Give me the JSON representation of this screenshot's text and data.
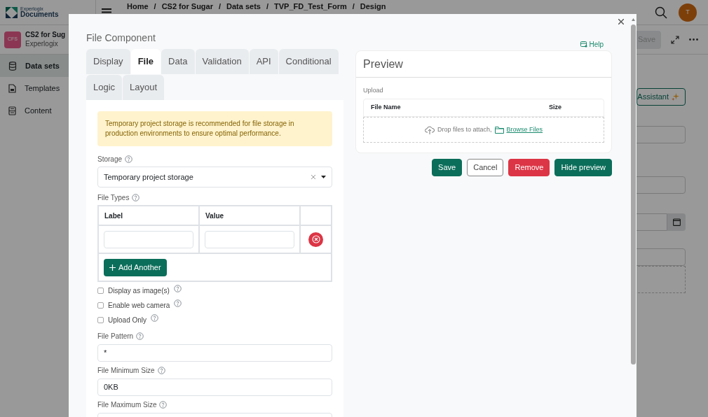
{
  "app": {
    "logo_top": "Experlogix",
    "logo_bottom": "Documents",
    "project": {
      "badge": "CFS",
      "name": "CS2 for Sug",
      "org": "Experlogix"
    },
    "nav": [
      {
        "label": "Data sets",
        "selected": true
      },
      {
        "label": "Templates",
        "selected": false
      },
      {
        "label": "Content",
        "selected": false
      }
    ],
    "breadcrumb": [
      {
        "kind": "link",
        "text": "Home"
      },
      {
        "kind": "separator",
        "text": "/"
      },
      {
        "kind": "link",
        "text": "CS2 for Sugar"
      },
      {
        "kind": "separator",
        "text": "/"
      },
      {
        "kind": "link",
        "text": "Data sets"
      },
      {
        "kind": "separator",
        "text": "/"
      },
      {
        "kind": "link",
        "text": "TVP_FD_Test_Form"
      },
      {
        "kind": "separator",
        "text": "/"
      },
      {
        "kind": "link",
        "text": "Design"
      }
    ],
    "avatar": "T",
    "save": "Save",
    "assistant": "Assistant"
  },
  "modal": {
    "title": "File Component",
    "help": "Help",
    "tabs": [
      {
        "label": "Display",
        "selected": false
      },
      {
        "label": "File",
        "selected": true
      },
      {
        "label": "Data",
        "selected": false
      },
      {
        "label": "Validation",
        "selected": false
      },
      {
        "label": "API",
        "selected": false
      },
      {
        "label": "Conditional",
        "selected": false
      },
      {
        "label": "Logic",
        "selected": false
      },
      {
        "label": "Layout",
        "selected": false
      }
    ],
    "alert": "Temporary project storage is recommended for file storage in production environments to ensure optimal performance.",
    "storage": {
      "label": "Storage",
      "value": "Temporary project storage"
    },
    "file_types": {
      "label": "File Types",
      "columns": [
        "Label",
        "Value"
      ],
      "add_button": "Add Another"
    },
    "checkboxes": [
      {
        "label": "Display as image(s)",
        "checked": false
      },
      {
        "label": "Enable web camera",
        "checked": false
      },
      {
        "label": "Upload Only",
        "checked": false
      }
    ],
    "fields": [
      {
        "label": "File Pattern",
        "value": "*"
      },
      {
        "label": "File Minimum Size",
        "value": "0KB"
      },
      {
        "label": "File Maximum Size"
      }
    ],
    "preview": {
      "title": "Preview",
      "upload_label": "Upload",
      "columns": [
        "File Name",
        "Size"
      ],
      "drop_text": "Drop files to attach,",
      "browse": "Browse Files"
    },
    "buttons": [
      {
        "label": "Save",
        "kind": "primary"
      },
      {
        "label": "Cancel",
        "kind": "outline"
      },
      {
        "label": "Remove",
        "kind": "danger"
      },
      {
        "label": "Hide preview",
        "kind": "primary"
      }
    ]
  }
}
